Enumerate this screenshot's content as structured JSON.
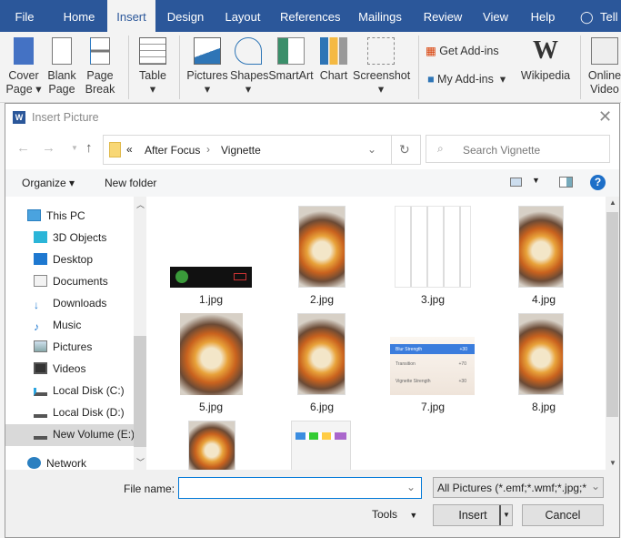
{
  "ribbon_tabs": [
    "File",
    "Home",
    "Insert",
    "Design",
    "Layout",
    "References",
    "Mailings",
    "Review",
    "View",
    "Help",
    "Tell"
  ],
  "active_tab": "Insert",
  "ribbon": {
    "cover_page": "Cover Page",
    "blank_page": "Blank Page",
    "page_break": "Page Break",
    "table": "Table",
    "pictures": "Pictures",
    "shapes": "Shapes",
    "smartart": "SmartArt",
    "chart": "Chart",
    "screenshot": "Screenshot",
    "get_addins": "Get Add-ins",
    "my_addins": "My Add-ins",
    "wikipedia": "Wikipedia",
    "online_video": "Online Video"
  },
  "dialog": {
    "title": "Insert Picture",
    "breadcrumb": {
      "prefix": "«",
      "items": [
        "After Focus",
        "Vignette"
      ]
    },
    "search_placeholder": "Search Vignette",
    "toolbar": {
      "organize": "Organize",
      "new_folder": "New folder",
      "help": "?"
    },
    "nav_items": [
      "This PC",
      "3D Objects",
      "Desktop",
      "Documents",
      "Downloads",
      "Music",
      "Pictures",
      "Videos",
      "Local Disk (C:)",
      "Local Disk (D:)",
      "New Volume (E:)",
      "Network"
    ],
    "selected_nav": "New Volume (E:)",
    "files": [
      "1.jpg",
      "2.jpg",
      "3.jpg",
      "4.jpg",
      "5.jpg",
      "6.jpg",
      "7.jpg",
      "8.jpg"
    ],
    "thumb7_rows": [
      {
        "label": "Blur Strength",
        "value": "+30"
      },
      {
        "label": "Transition",
        "value": "+70"
      },
      {
        "label": "Vignette Strength",
        "value": "+30"
      }
    ],
    "file_name_label": "File name:",
    "file_name_value": "",
    "file_type": "All Pictures (*.emf;*.wmf;*.jpg;*",
    "tools": "Tools",
    "insert": "Insert",
    "cancel": "Cancel"
  },
  "colors": {
    "word_blue": "#2b579a",
    "selection": "#cce8ff",
    "accent": "#0078d7"
  }
}
